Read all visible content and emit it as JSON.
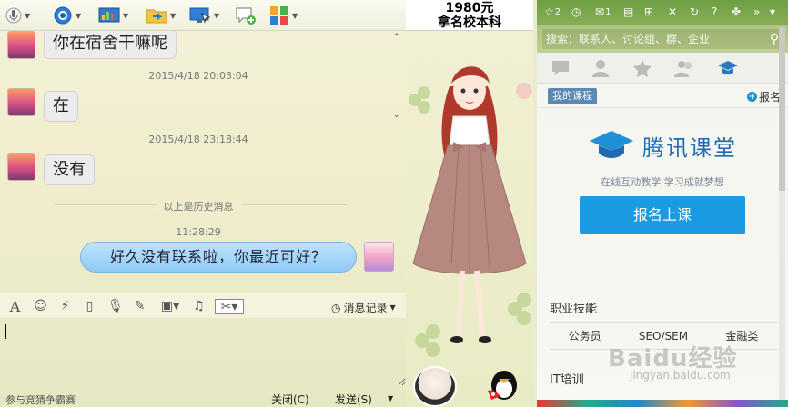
{
  "chat": {
    "messages": [
      {
        "text": "你在宿舍干嘛呢"
      },
      {
        "timestamp": "2015/4/18 20:03:04",
        "text": "在"
      },
      {
        "timestamp": "2015/4/18 23:18:44",
        "text": "没有"
      }
    ],
    "history_divider": "以上是历史消息",
    "current_time": "11:28:29",
    "my_message": "好久没有联系啦，你最近可好？",
    "input_toolbar": {
      "message_record_label": "消息记录"
    },
    "bottom": {
      "ad_text": "参与竞猜争霸赛",
      "close_label": "关闭(C)",
      "send_label": "发送(S)"
    }
  },
  "banner": {
    "ad_line1": "1980元",
    "ad_line2": "拿名校本科"
  },
  "right_panel": {
    "top_badges": {
      "stars": "2",
      "mail": "1"
    },
    "search_placeholder": "搜索：联系人、讨论组、群、企业",
    "my_course_tag": "我的课程",
    "enroll_link": "报名",
    "brand_name": "腾讯课堂",
    "slogan": "在线互动教学 学习成就梦想",
    "enroll_button": "报名上课",
    "section_career": "职业技能",
    "career_items": [
      "公务员",
      "SEO/SEM",
      "金融类"
    ],
    "section_it": "IT培训",
    "watermark": "Baidu经验",
    "watermark_sub": "jingyan.baidu.com"
  },
  "colors": {
    "my_bubble": "#8ecaf6",
    "enroll_button": "#1a9ae0",
    "brand": "#1f6ab0",
    "panel_header": "#6f9f43"
  }
}
